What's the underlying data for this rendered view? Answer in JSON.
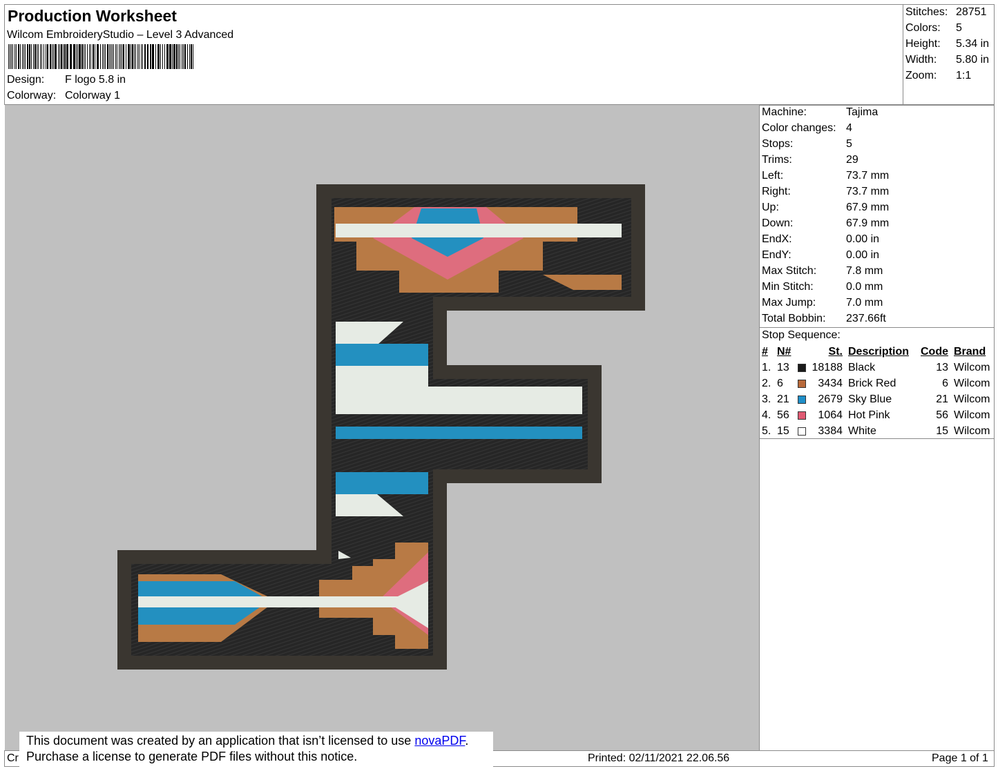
{
  "header": {
    "title": "Production Worksheet",
    "software": "Wilcom EmbroideryStudio – Level 3 Advanced",
    "design_label": "Design:",
    "design_value": "F logo 5.8 in",
    "colorway_label": "Colorway:",
    "colorway_value": "Colorway 1"
  },
  "summary": [
    {
      "label": "Stitches:",
      "value": "28751"
    },
    {
      "label": "Colors:",
      "value": "5"
    },
    {
      "label": "Height:",
      "value": "5.34 in"
    },
    {
      "label": "Width:",
      "value": "5.80 in"
    },
    {
      "label": "Zoom:",
      "value": "1:1"
    }
  ],
  "machine_info": [
    {
      "label": "Machine:",
      "value": "Tajima"
    },
    {
      "label": "Color changes:",
      "value": "4"
    },
    {
      "label": "Stops:",
      "value": "5"
    },
    {
      "label": "Trims:",
      "value": "29"
    },
    {
      "label": "Left:",
      "value": "73.7 mm"
    },
    {
      "label": "Right:",
      "value": "73.7 mm"
    },
    {
      "label": "Up:",
      "value": "67.9 mm"
    },
    {
      "label": "Down:",
      "value": "67.9 mm"
    },
    {
      "label": "EndX:",
      "value": "0.00 in"
    },
    {
      "label": "EndY:",
      "value": "0.00 in"
    },
    {
      "label": "Max Stitch:",
      "value": "7.8 mm"
    },
    {
      "label": "Min Stitch:",
      "value": "0.0 mm"
    },
    {
      "label": "Max Jump:",
      "value": "7.0 mm"
    },
    {
      "label": "Total Bobbin:",
      "value": "237.66ft"
    }
  ],
  "stop_sequence": {
    "title": "Stop Sequence:",
    "headers": {
      "num": "#",
      "n": "N#",
      "st": "St.",
      "desc": "Description",
      "code": "Code",
      "brand": "Brand"
    },
    "rows": [
      {
        "num": "1.",
        "n": "13",
        "color": "#1a1a1a",
        "st": "18188",
        "desc": "Black",
        "code": "13",
        "brand": "Wilcom"
      },
      {
        "num": "2.",
        "n": "6",
        "color": "#b8693a",
        "st": "3434",
        "desc": "Brick Red",
        "code": "6",
        "brand": "Wilcom"
      },
      {
        "num": "3.",
        "n": "21",
        "color": "#1f8fc9",
        "st": "2679",
        "desc": "Sky Blue",
        "code": "21",
        "brand": "Wilcom"
      },
      {
        "num": "4.",
        "n": "56",
        "color": "#e05a73",
        "st": "1064",
        "desc": "Hot Pink",
        "code": "56",
        "brand": "Wilcom"
      },
      {
        "num": "5.",
        "n": "15",
        "color": "#ffffff",
        "st": "3384",
        "desc": "White",
        "code": "15",
        "brand": "Wilcom"
      }
    ]
  },
  "footer": {
    "left_fragment": "Cr",
    "printed": "Printed: 02/11/2021 22.06.56",
    "page": "Page 1 of 1"
  },
  "notice": {
    "line1_pre": "This document was created by an application that isn’t licensed to use ",
    "link": "novaPDF",
    "line1_post": ".",
    "line2": "Purchase a license to generate PDF files without this notice."
  },
  "colors": {
    "preview_bg": "#c0c0c0",
    "outline": "#3a3630",
    "fill": "#262626",
    "brick": "#b87a45",
    "blue": "#2390c0",
    "pink": "#de6d7e",
    "white": "#e6ebe4"
  }
}
